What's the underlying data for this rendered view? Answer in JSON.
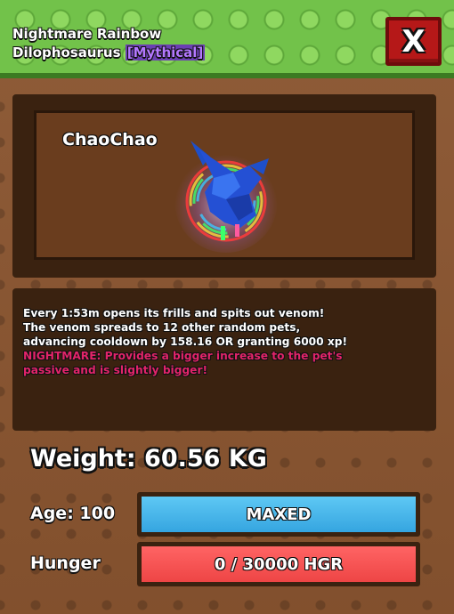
{
  "header": {
    "title_line1": "Nightmare Rainbow",
    "title_line2": "Dilophosaurus",
    "rarity": "[Mythical]",
    "close_label": "X"
  },
  "pet": {
    "name": "ChaoChao"
  },
  "description": {
    "lines": [
      "Every 1:53m opens its frills and spits out venom!",
      "The venom spreads to 12 other random pets,",
      "advancing cooldown by 158.16 OR granting 6000 xp!"
    ],
    "nightmare_lines": [
      "NIGHTMARE: Provides a bigger increase to the pet's",
      "passive and is slightly bigger!"
    ]
  },
  "stats": {
    "weight": "Weight: 60.56 KG",
    "age_label": "Age: 100",
    "age_bar_text": "MAXED",
    "age_fill": 1.0,
    "hunger_label": "Hunger",
    "hunger_bar_text": "0 / 30000 HGR",
    "hunger_fill": 1.0
  },
  "colors": {
    "header_green": "#72c24a",
    "rarity_purple": "#b478ff",
    "nightmare_pink": "#e2246a",
    "age_bar_blue": "#35a5e0",
    "hunger_bar_red": "#ee4545",
    "close_red": "#b51818"
  }
}
